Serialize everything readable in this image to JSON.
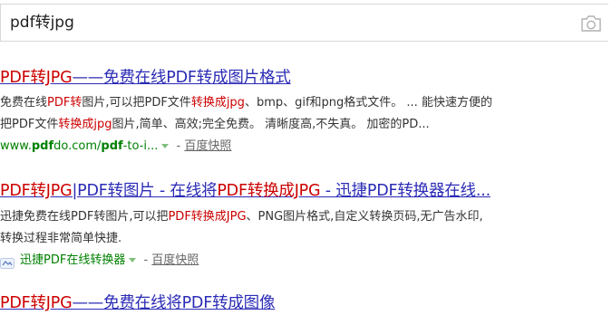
{
  "search": {
    "value": "pdf转jpg"
  },
  "icons": {
    "camera": "camera-icon",
    "site": "site-logo-icon",
    "dropdown": "dropdown-arrow-icon"
  },
  "colors": {
    "title_link": "#2b2bb6",
    "highlight": "#c00000",
    "url_green": "#008000",
    "text": "#333333",
    "muted": "#666666"
  },
  "results": [
    {
      "title": [
        "PDF转JPG",
        "——免费在线PDF转成图片格式"
      ],
      "desc1": [
        "免费在线",
        "PDF转",
        "图片,可以把PDF文件",
        "转换成jpg",
        "、bmp、gif和png格式文件。 ... 能快速方便的"
      ],
      "desc2": [
        "把PDF文件",
        "转换成jpg",
        "图片,简单、高效;完全免费。 清晰度高,不失真。 加密的PD..."
      ],
      "url": [
        "www.",
        "pdf",
        "do.com/",
        "pdf",
        "-to-i..."
      ],
      "sep": " - ",
      "snapshot": "百度快照"
    },
    {
      "title": [
        "PDF转JPG",
        "|PDF转图片 - 在线将",
        "PDF转换成JPG",
        " - 迅捷PDF转换器在线..."
      ],
      "desc1": [
        "迅捷免费在线PDF转图片,可以把",
        "PDF转换成JPG",
        "、PNG图片格式,自定义转换页码,无广告水印,"
      ],
      "desc2": [
        "转换过程非常简单快捷."
      ],
      "site": "迅捷PDF在线转换器",
      "sep": " - ",
      "snapshot": "百度快照"
    },
    {
      "title": [
        "PDF转JPG",
        "——免费在线将PDF转成图像"
      ]
    }
  ]
}
